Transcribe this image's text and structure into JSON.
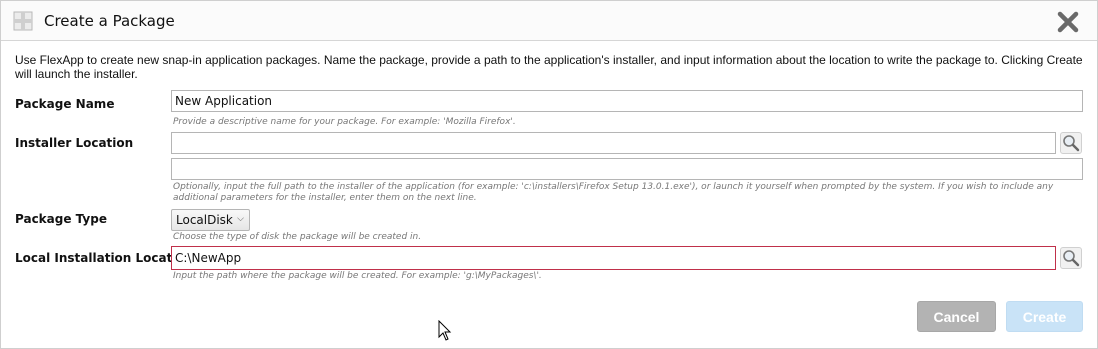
{
  "dialog": {
    "title": "Create a Package",
    "description": "Use FlexApp to create new snap-in application packages. Name the package, provide a path to the application's installer, and input information about the location to write the package to. Clicking Create will launch the installer.",
    "icons": {
      "package": "package-icon",
      "close": "close-icon"
    }
  },
  "fields": {
    "package_name": {
      "label": "Package Name",
      "value": "New Application",
      "hint": "Provide a descriptive name for your package. For example: 'Mozilla Firefox'."
    },
    "installer_location": {
      "label": "Installer Location",
      "value": "",
      "params_value": "",
      "hint": "Optionally, input the full path to the installer of the application (for example: 'c:\\installers\\Firefox Setup 13.0.1.exe'), or launch it yourself when prompted by the system. If you wish to include any additional parameters for the installer, enter them on the next line."
    },
    "package_type": {
      "label": "Package Type",
      "selected": "LocalDisk",
      "hint": "Choose the type of disk the package will be created in."
    },
    "local_installation_location": {
      "label": "Local Installation Location",
      "value": "C:\\NewApp",
      "hint": "Input the path where the package will be created. For example: 'g:\\MyPackages\\'."
    }
  },
  "buttons": {
    "cancel": "Cancel",
    "create": "Create"
  },
  "colors": {
    "focus_border": "#c0304a",
    "cancel_bg": "#b3b3b3",
    "create_bg": "#c9e3f7"
  }
}
